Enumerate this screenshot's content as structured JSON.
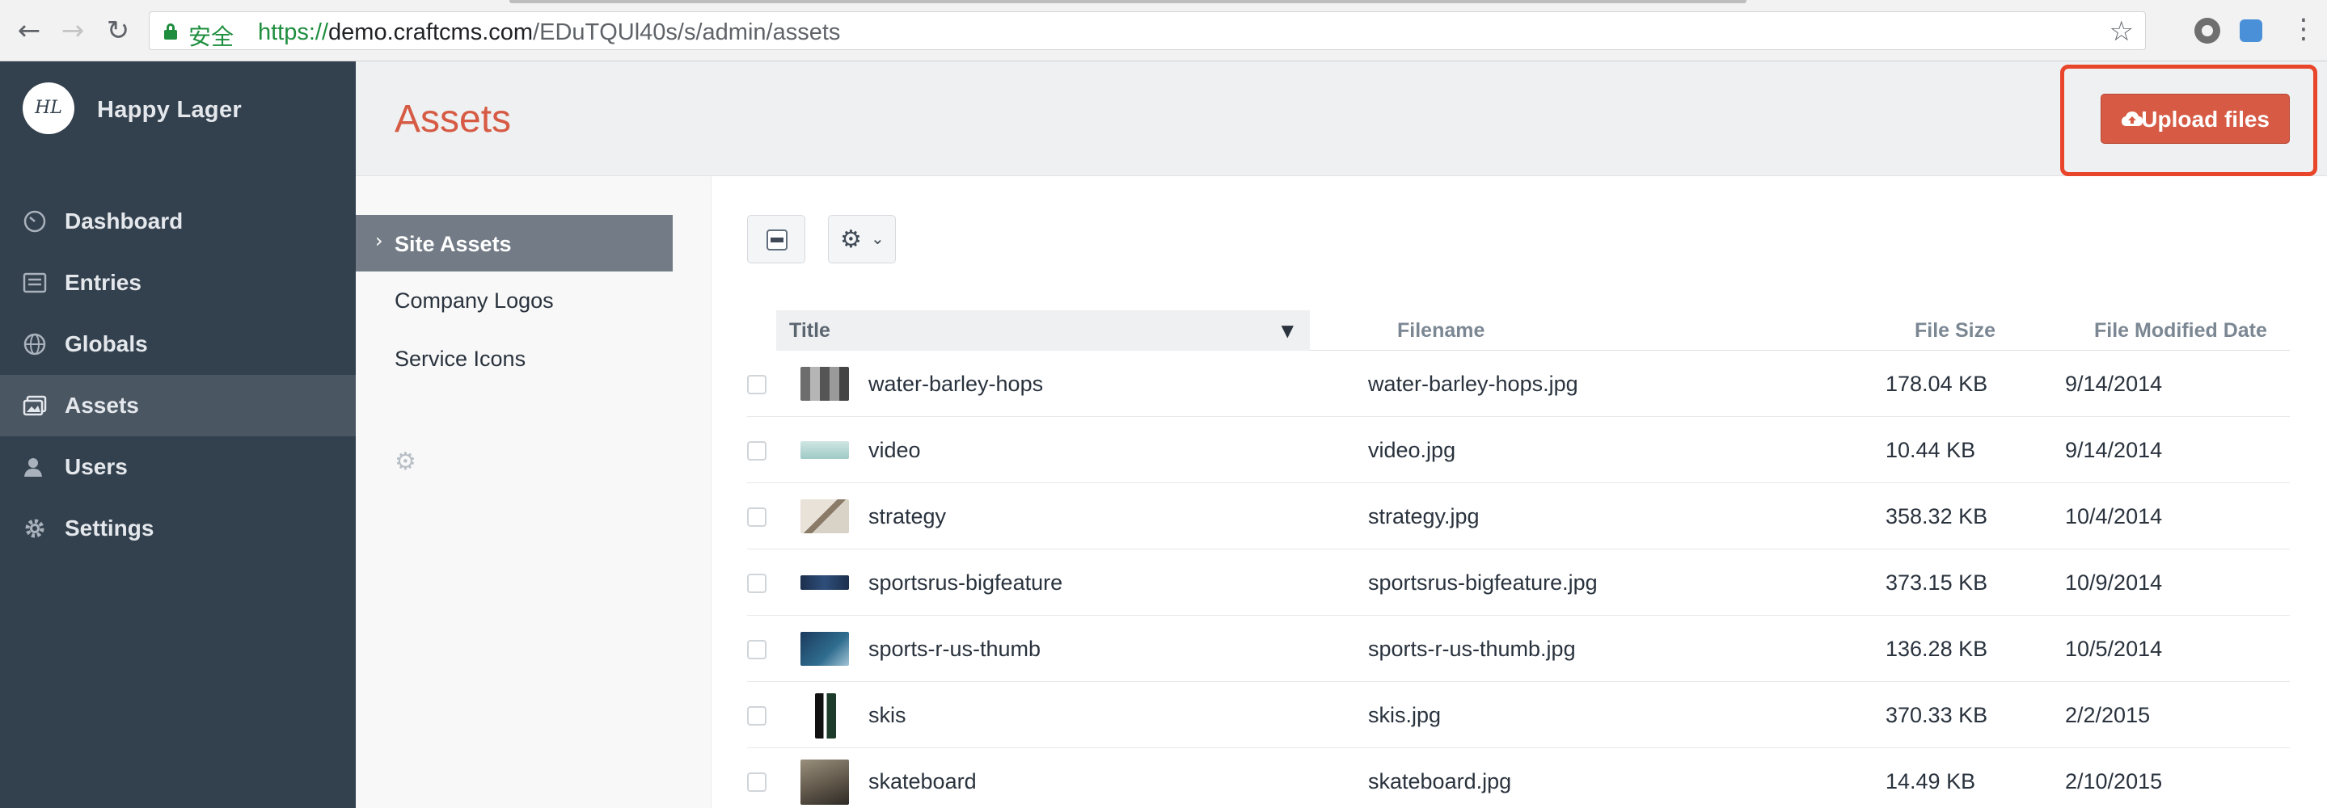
{
  "browser": {
    "secure_label": "安全",
    "url_scheme": "https://",
    "url_host": "demo.craftcms.com",
    "url_path": "/EDuTQUl40s/s/admin/assets"
  },
  "sidebar": {
    "logo_text": "HL",
    "site_name": "Happy Lager",
    "items": [
      {
        "label": "Dashboard",
        "icon": "dashboard-icon"
      },
      {
        "label": "Entries",
        "icon": "entries-icon"
      },
      {
        "label": "Globals",
        "icon": "globe-icon"
      },
      {
        "label": "Assets",
        "icon": "assets-icon",
        "selected": true
      },
      {
        "label": "Users",
        "icon": "users-icon"
      },
      {
        "label": "Settings",
        "icon": "gear-icon"
      }
    ]
  },
  "header": {
    "title": "Assets",
    "upload_label": "Upload files"
  },
  "sources": {
    "items": [
      {
        "label": "Site Assets",
        "selected": true
      },
      {
        "label": "Company Logos"
      },
      {
        "label": "Service Icons"
      }
    ]
  },
  "table": {
    "columns": [
      "Title",
      "Filename",
      "File Size",
      "File Modified Date"
    ],
    "sorted_column": "Title",
    "rows": [
      {
        "title": "water-barley-hops",
        "filename": "water-barley-hops.jpg",
        "size": "178.04 KB",
        "date": "9/14/2014"
      },
      {
        "title": "video",
        "filename": "video.jpg",
        "size": "10.44 KB",
        "date": "9/14/2014"
      },
      {
        "title": "strategy",
        "filename": "strategy.jpg",
        "size": "358.32 KB",
        "date": "10/4/2014"
      },
      {
        "title": "sportsrus-bigfeature",
        "filename": "sportsrus-bigfeature.jpg",
        "size": "373.15 KB",
        "date": "10/9/2014"
      },
      {
        "title": "sports-r-us-thumb",
        "filename": "sports-r-us-thumb.jpg",
        "size": "136.28 KB",
        "date": "10/5/2014"
      },
      {
        "title": "skis",
        "filename": "skis.jpg",
        "size": "370.33 KB",
        "date": "2/2/2015"
      },
      {
        "title": "skateboard",
        "filename": "skateboard.jpg",
        "size": "14.49 KB",
        "date": "2/10/2015"
      }
    ]
  },
  "colors": {
    "accent": "#d65a44",
    "sidebar_bg": "#33404d",
    "highlight": "#e8452a"
  }
}
